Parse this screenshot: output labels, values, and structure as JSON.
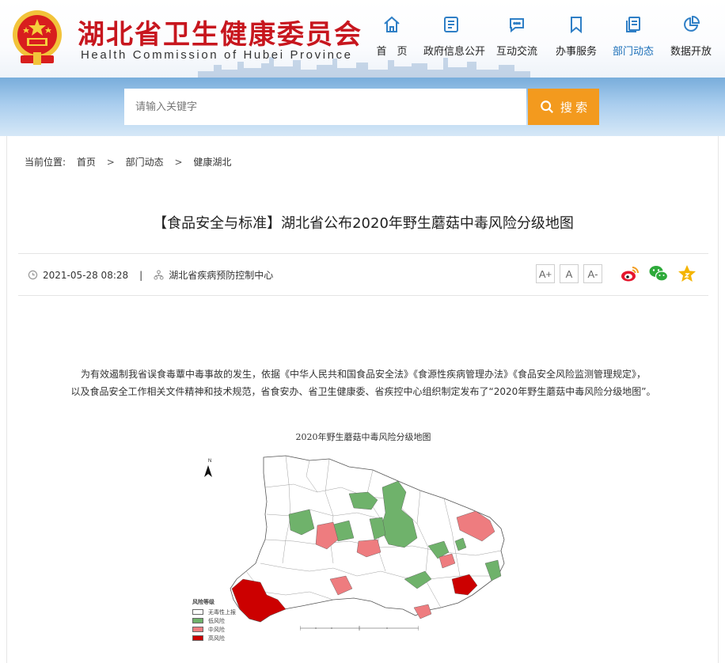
{
  "header": {
    "org_name": "湖北省卫生健康委员会",
    "org_name_en": "Health Commission of Hubei Province",
    "nav": [
      {
        "label": "首　页",
        "icon": "home-icon"
      },
      {
        "label": "政府信息公开",
        "icon": "document-icon"
      },
      {
        "label": "互动交流",
        "icon": "chat-icon"
      },
      {
        "label": "办事服务",
        "icon": "bookmark-icon"
      },
      {
        "label": "部门动态",
        "icon": "copy-icon",
        "active": true
      },
      {
        "label": "数据开放",
        "icon": "pie-chart-icon"
      }
    ],
    "active_color": "#1b6fb8",
    "brand_color": "#c7161e"
  },
  "search": {
    "placeholder": "请输入关键字",
    "button_label": "搜 索",
    "button_color": "#f39a1e"
  },
  "breadcrumb": {
    "label": "当前位置:",
    "items": [
      "首页",
      "部门动态",
      "健康湖北"
    ],
    "separator": ">"
  },
  "article": {
    "title": "【食品安全与标准】湖北省公布2020年野生蘑菇中毒风险分级地图",
    "datetime": "2021-05-28 08:28",
    "divider": "|",
    "source": "湖北省疾病预防控制中心",
    "font_buttons": [
      "A+",
      "A",
      "A-"
    ],
    "paragraph_lines": [
      "为有效遏制我省误食毒蕈中毒事故的发生，依据《中华人民共和国食品安全法》《食源性疾病管理办法》《食品安全风险监测管理规定》，",
      "以及食品安全工作相关文件精神和技术规范，省食安办、省卫生健康委、省疾控中心组织制定发布了“2020年野生蘑菇中毒风险分级地图”。"
    ]
  },
  "map": {
    "title": "2020年野生蘑菇中毒风险分级地图",
    "north_label": "N",
    "legend_title": "风险等级",
    "legend": [
      {
        "label": "无毒性上报",
        "color": "#ffffff"
      },
      {
        "label": "低风险",
        "color": "#6fb26b"
      },
      {
        "label": "中风险",
        "color": "#ee7c7f"
      },
      {
        "label": "高风险",
        "color": "#cc0000"
      }
    ]
  }
}
